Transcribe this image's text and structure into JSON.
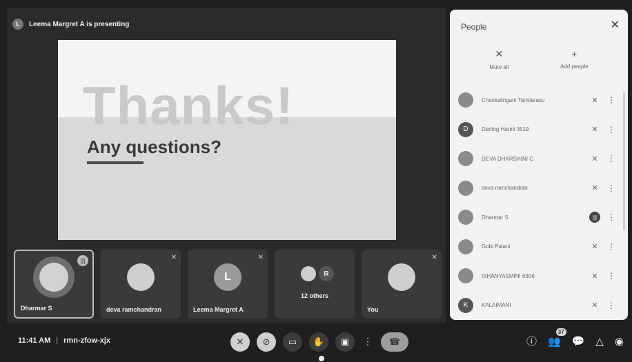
{
  "presenting": {
    "avatar_letter": "L",
    "text": "Leema Margret A is presenting"
  },
  "slide": {
    "title": "Thanks!",
    "subtitle": "Any questions?"
  },
  "tiles": [
    {
      "name": "Dharmar S"
    },
    {
      "name": "deva ramchandran"
    },
    {
      "name": "Leema Margret A",
      "letter": "L"
    },
    {
      "name": "12 others",
      "badge_letter": "R"
    },
    {
      "name": "You"
    }
  ],
  "bottom": {
    "time": "11:41 AM",
    "code": "rmn-zfow-xjx",
    "people_badge": "37"
  },
  "panel": {
    "title": "People",
    "actions": [
      {
        "label": "Mute all",
        "icon": "mic-off-icon"
      },
      {
        "label": "Add people",
        "icon": "add-person-icon"
      }
    ],
    "people": [
      {
        "name": "Chockalingam Tamilarasu",
        "initial": ""
      },
      {
        "name": "Darling Harini 3519",
        "initial": "D"
      },
      {
        "name": "DEVA DHARSHINI C",
        "initial": ""
      },
      {
        "name": "deva ramchandran",
        "initial": ""
      },
      {
        "name": "Dharmar S",
        "initial": "",
        "speaking": true
      },
      {
        "name": "Gobi Palani",
        "initial": ""
      },
      {
        "name": "ISHANYASMINI 6306",
        "initial": ""
      },
      {
        "name": "KALAIMANI",
        "initial": "K"
      }
    ]
  }
}
